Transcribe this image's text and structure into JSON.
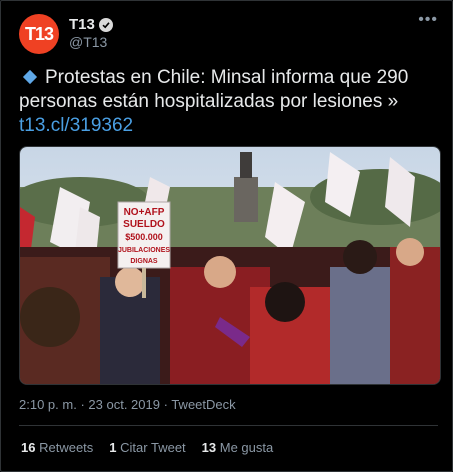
{
  "account": {
    "avatar_text": "T13",
    "name": "T13",
    "handle": "@T13",
    "verified": true
  },
  "tweet": {
    "text": "Protestas en Chile: Minsal informa que 290 personas están hospitalizadas por lesiones »",
    "link": "t13.cl/319362"
  },
  "media": {
    "sign_lines": [
      "NO+AFP",
      "SUELDO",
      "$500.000",
      "JUBILACIONES",
      "DIGNAS"
    ]
  },
  "meta": {
    "time": "2:10 p. m.",
    "date": "23 oct. 2019",
    "source": "TweetDeck",
    "separator": "·"
  },
  "stats": {
    "retweets_count": "16",
    "retweets_label": "Retweets",
    "quotes_count": "1",
    "quotes_label": "Citar Tweet",
    "likes_count": "13",
    "likes_label": "Me gusta"
  },
  "colors": {
    "avatar_bg": "#ef4123",
    "link": "#4a9fe3",
    "diamond": "#5fa8e8"
  },
  "icons": [
    "verified-badge-icon",
    "more-options-icon",
    "small-blue-diamond-icon"
  ]
}
